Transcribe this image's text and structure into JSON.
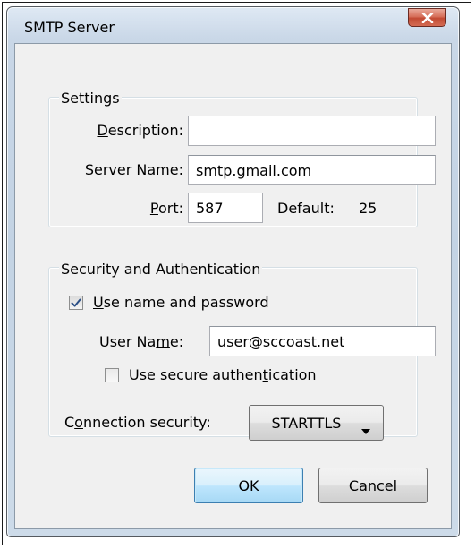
{
  "dialog": {
    "title": "SMTP Server",
    "close_icon": "close-icon"
  },
  "settings": {
    "group_label": "Settings",
    "description_label_key": "D",
    "description_label_rest": "escription:",
    "description_value": "",
    "server_name_label_key": "S",
    "server_name_label_rest": "erver Name:",
    "server_name_value": "smtp.gmail.com",
    "port_label_key": "P",
    "port_label_rest": "ort:",
    "port_value": "587",
    "default_label": "Default:",
    "default_value": "25"
  },
  "security": {
    "group_label": "Security and Authentication",
    "use_name_password_key": "U",
    "use_name_password_rest": "se name and password",
    "use_name_password_checked": true,
    "user_name_label_pre": "User Na",
    "user_name_label_key": "m",
    "user_name_label_post": "e:",
    "user_name_value": "user@sccoast.net",
    "secure_auth_pre": "Use secure authen",
    "secure_auth_key": "t",
    "secure_auth_post": "ication",
    "secure_auth_checked": false,
    "connection_label_pre": "C",
    "connection_label_key": "o",
    "connection_label_post": "nnection security:",
    "connection_value": "STARTTLS",
    "dropdown_icon": "chevron-down-icon"
  },
  "buttons": {
    "ok_label": "OK",
    "cancel_label": "Cancel"
  },
  "colors": {
    "close_button": "#c9503a",
    "window_frame": "#c3d3e4",
    "default_button": "#bee6fd"
  }
}
